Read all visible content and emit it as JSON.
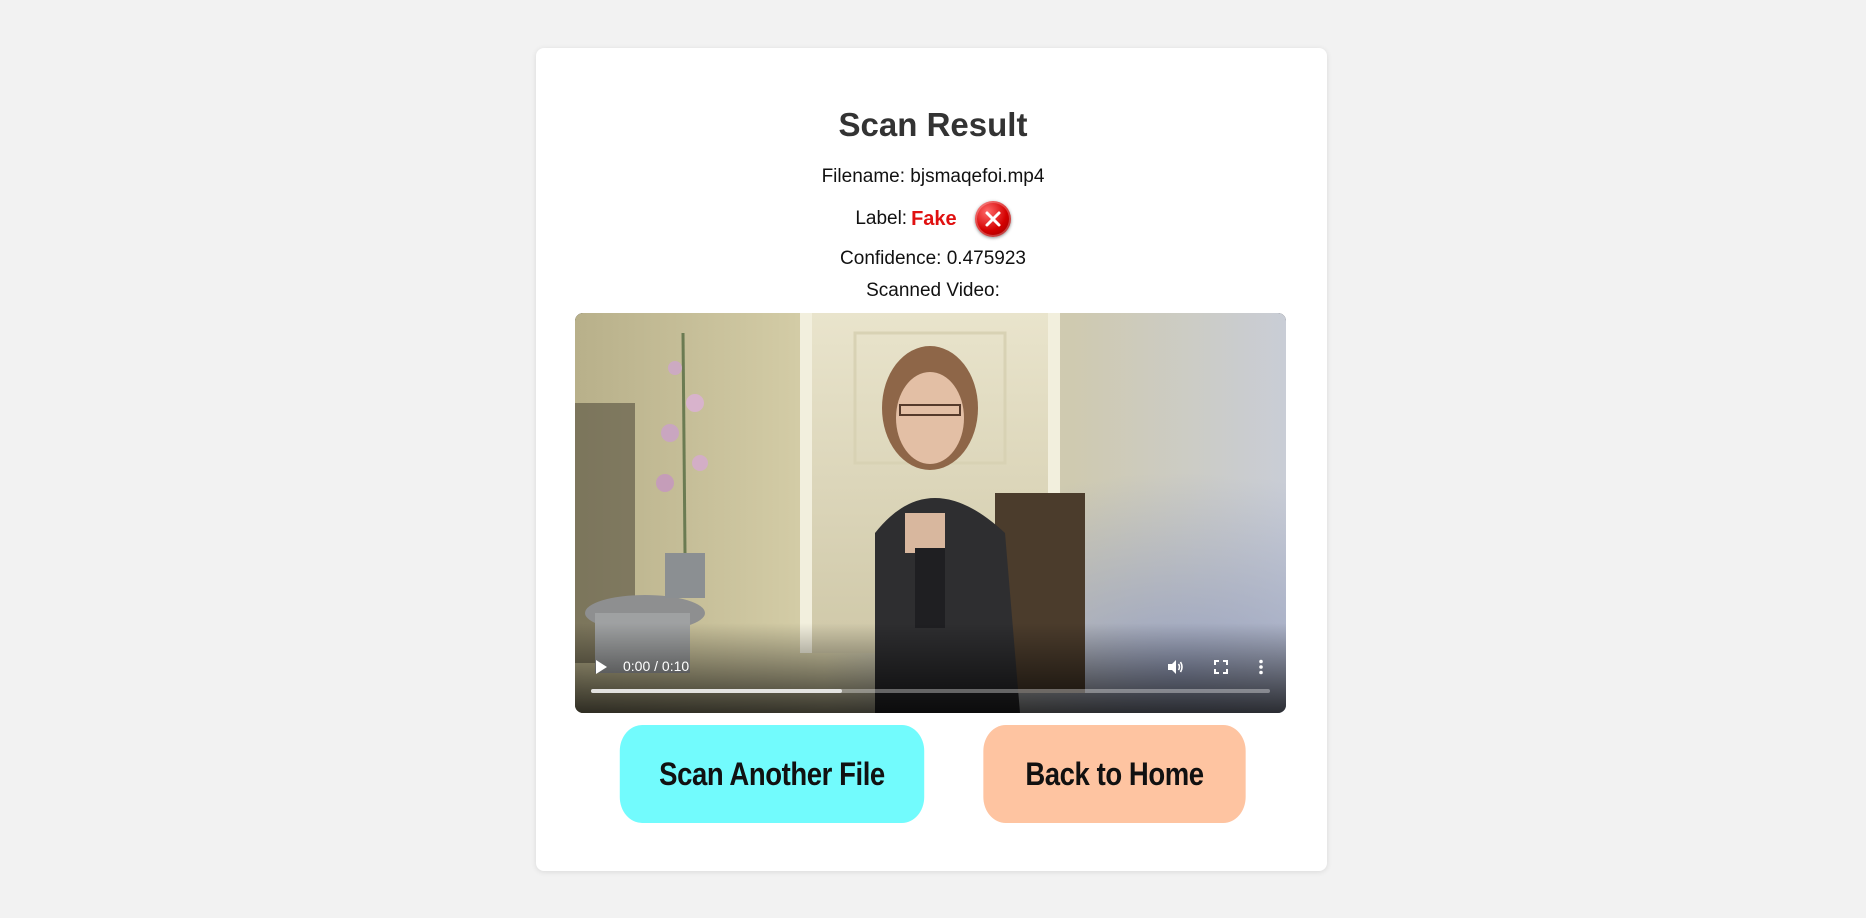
{
  "result": {
    "title": "Scan Result",
    "filename_label": "Filename: ",
    "filename": "bjsmaqefoi.mp4",
    "label_label": "Label: ",
    "label_value": "Fake",
    "confidence_label": "Confidence: ",
    "confidence": "0.475923",
    "video_caption": "Scanned Video:",
    "label_icon": "red-x-circle-icon",
    "label_color": "#e01111"
  },
  "video": {
    "time": "0:00 / 0:10",
    "progress_fraction": 0.37,
    "icons": [
      "play-icon",
      "volume-icon",
      "fullscreen-icon",
      "more-vert-icon"
    ]
  },
  "actions": {
    "scan_another": "Scan Another File",
    "back_home": "Back to Home",
    "scan_color": "#72fbfd",
    "home_color": "#fec4a1"
  }
}
